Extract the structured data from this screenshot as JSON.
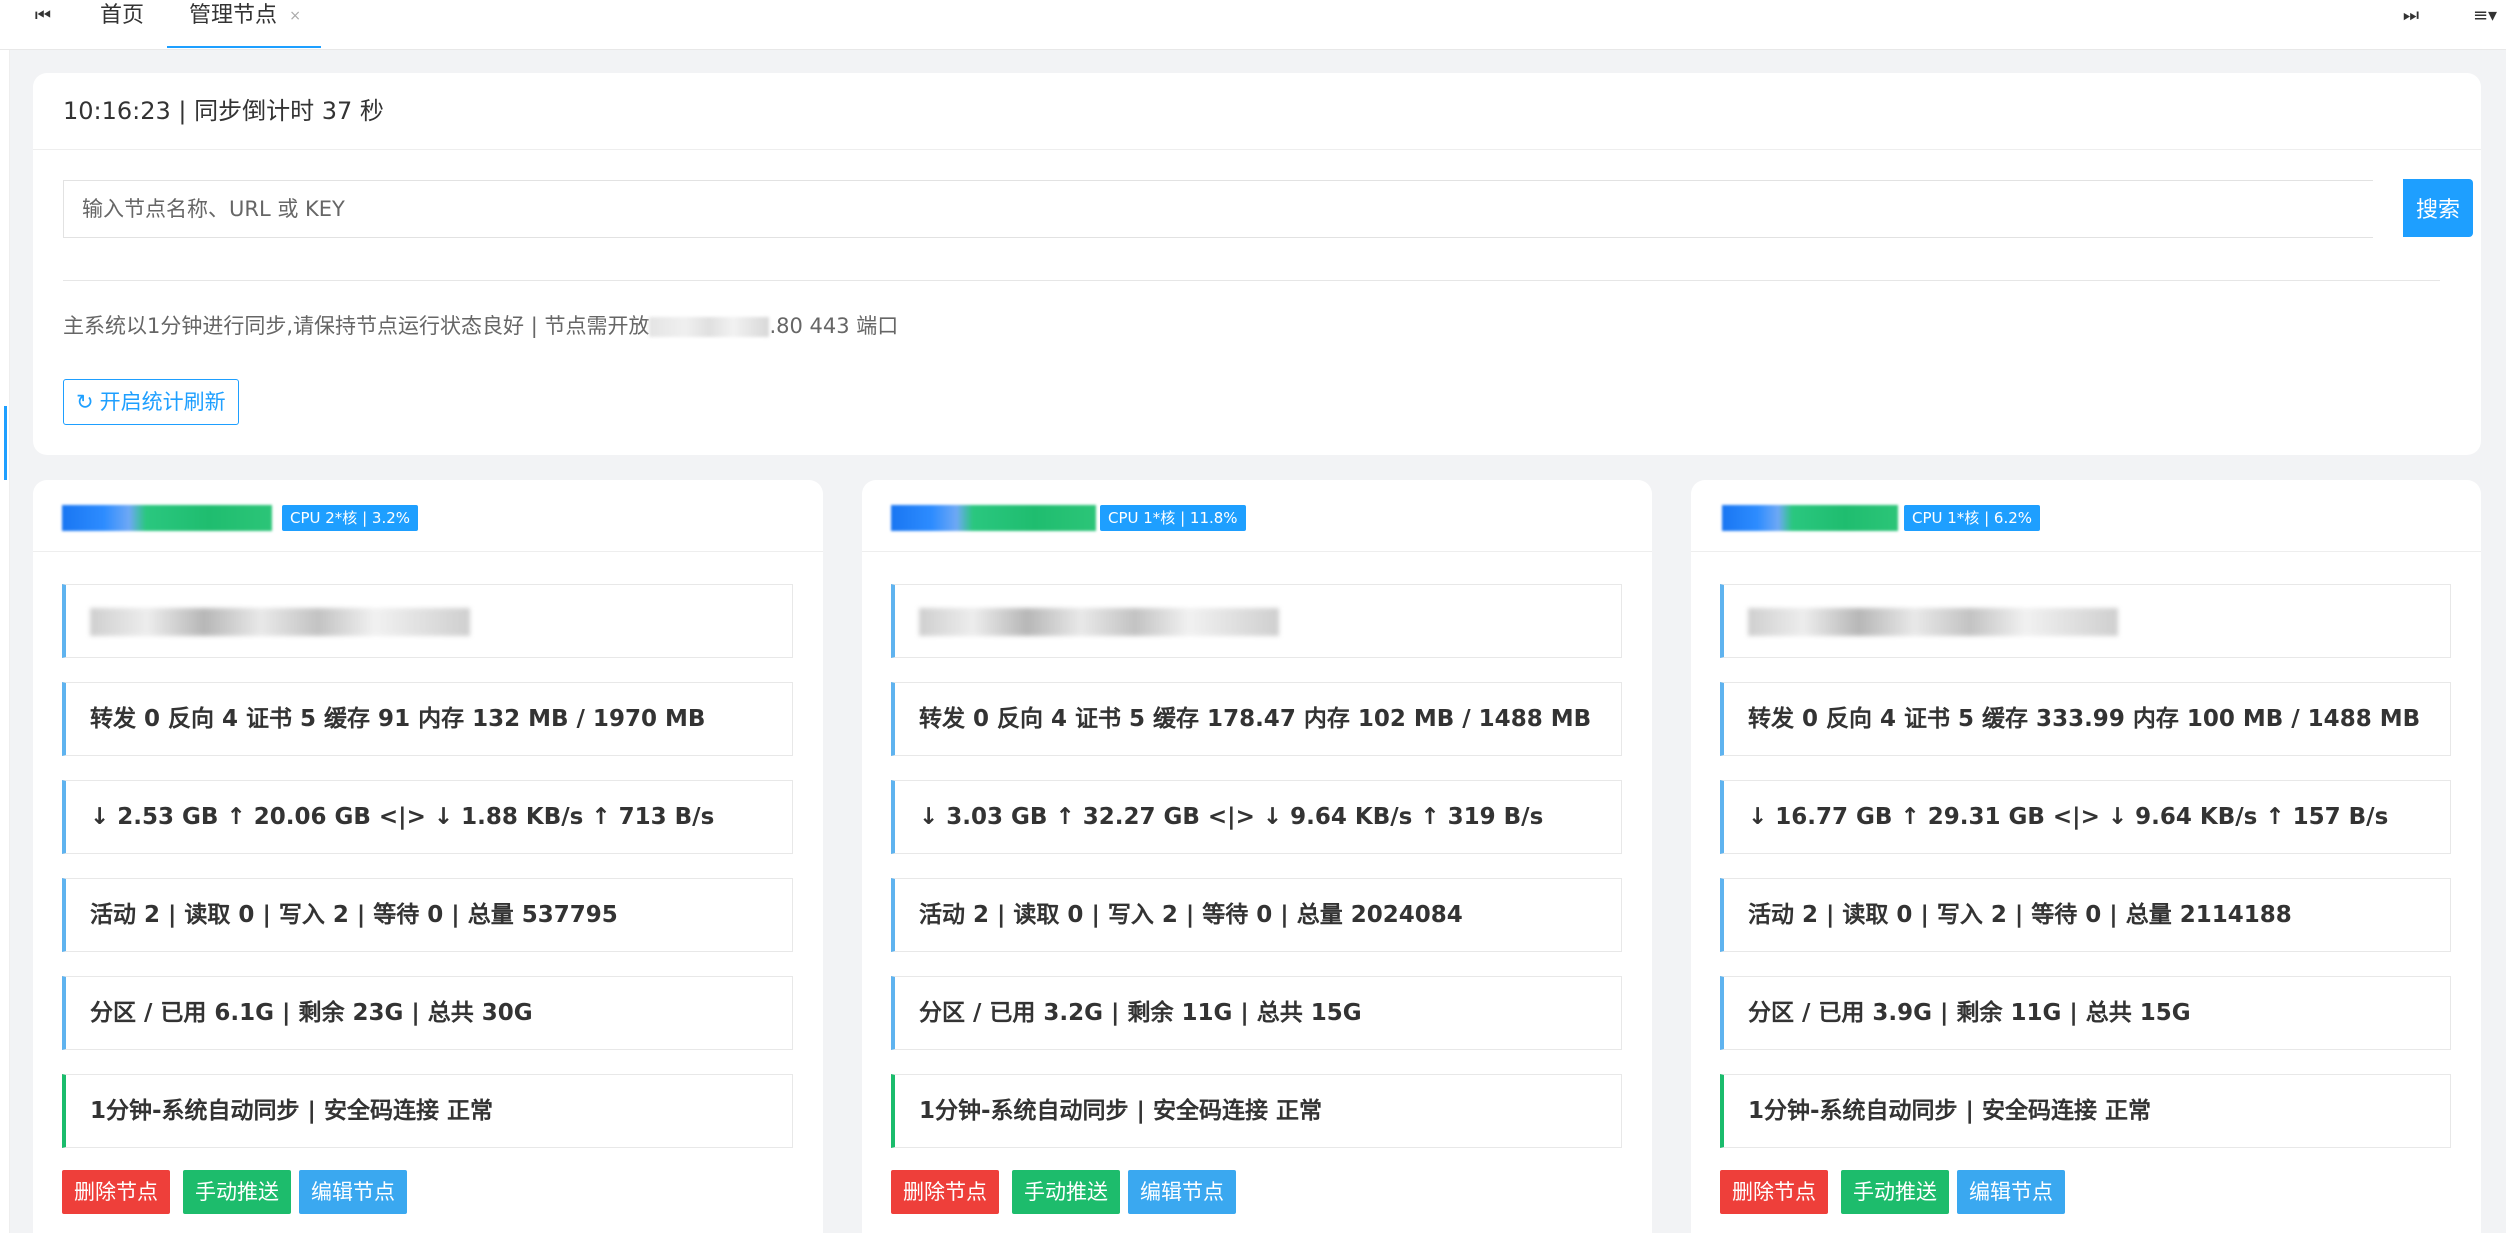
{
  "tabs": {
    "nav_left_icon": "⏮",
    "nav_right_icon": "⏭",
    "menu_icon": "≡▾",
    "home_label": "首页",
    "active_label": "管理节点",
    "close_icon": "×"
  },
  "panel": {
    "header": "10:16:23 | 同步倒计时 37 秒",
    "search_placeholder": "输入节点名称、URL 或 KEY",
    "search_button": "搜索",
    "notice_prefix": "主系统以1分钟进行同步,请保持节点运行状态良好 | 节点需开放",
    "notice_suffix": ".80 443 端口",
    "refresh_icon": "↻",
    "refresh_label": "开启统计刷新"
  },
  "cards": [
    {
      "cpu": "CPU 2*核 | 3.2%",
      "stats": "转发 0 反向 4 证书 5 缓存 91 内存 132 MB / 1970 MB",
      "traffic": "↓ 2.53 GB ↑ 20.06 GB <|> ↓ 1.88 KB/s ↑ 713 B/s",
      "connections": "活动 2 | 读取 0 | 写入 2 | 等待 0 | 总量 537795",
      "disk": "分区 / 已用 6.1G | 剩余 23G | 总共 30G",
      "sync": "1分钟-系统自动同步 | 安全码连接 正常",
      "btn_delete": "删除节点",
      "btn_push": "手动推送",
      "btn_edit": "编辑节点"
    },
    {
      "cpu": "CPU 1*核 | 11.8%",
      "stats": "转发 0 反向 4 证书 5 缓存 178.47 内存 102 MB / 1488 MB",
      "traffic": "↓ 3.03 GB ↑ 32.27 GB <|> ↓ 9.64 KB/s ↑ 319 B/s",
      "connections": "活动 2 | 读取 0 | 写入 2 | 等待 0 | 总量 2024084",
      "disk": "分区 / 已用 3.2G | 剩余 11G | 总共 15G",
      "sync": "1分钟-系统自动同步 | 安全码连接 正常",
      "btn_delete": "删除节点",
      "btn_push": "手动推送",
      "btn_edit": "编辑节点"
    },
    {
      "cpu": "CPU 1*核 | 6.2%",
      "stats": "转发 0 反向 4 证书 5 缓存 333.99 内存 100 MB / 1488 MB",
      "traffic": "↓ 16.77 GB ↑ 29.31 GB <|> ↓ 9.64 KB/s ↑ 157 B/s",
      "connections": "活动 2 | 读取 0 | 写入 2 | 等待 0 | 总量 2114188",
      "disk": "分区 / 已用 3.9G | 剩余 11G | 总共 15G",
      "sync": "1分钟-系统自动同步 | 安全码连接 正常",
      "btn_delete": "删除节点",
      "btn_push": "手动推送",
      "btn_edit": "编辑节点"
    }
  ]
}
